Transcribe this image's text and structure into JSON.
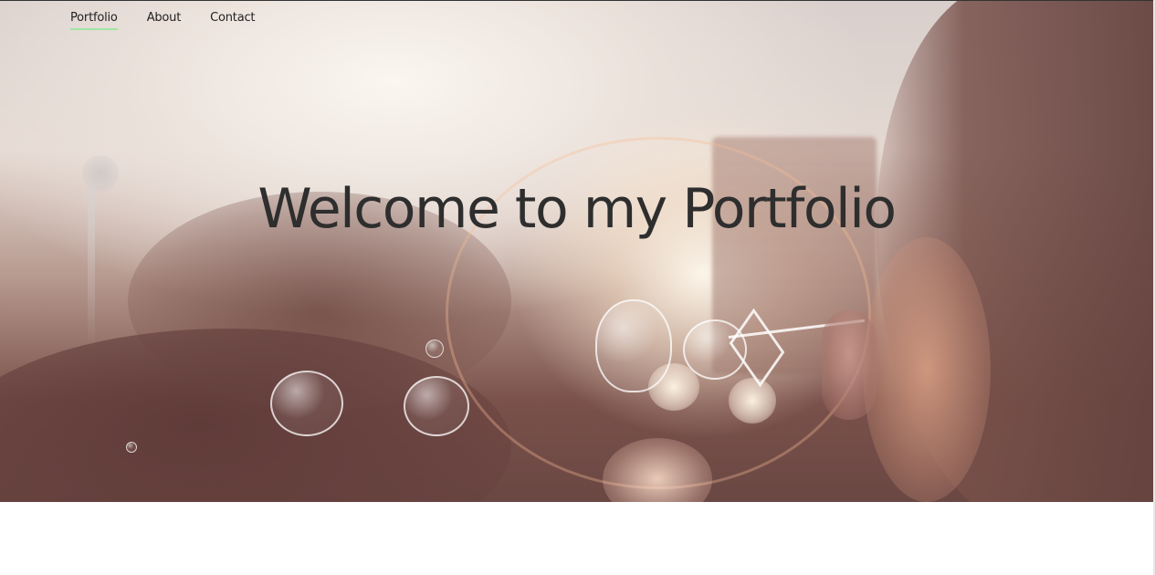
{
  "nav": {
    "items": [
      {
        "label": "Portfolio",
        "active": true
      },
      {
        "label": "About",
        "active": false
      },
      {
        "label": "Contact",
        "active": false
      }
    ],
    "active_underline_color": "#9ee6a4"
  },
  "hero": {
    "title": "Welcome to my Portfolio"
  }
}
